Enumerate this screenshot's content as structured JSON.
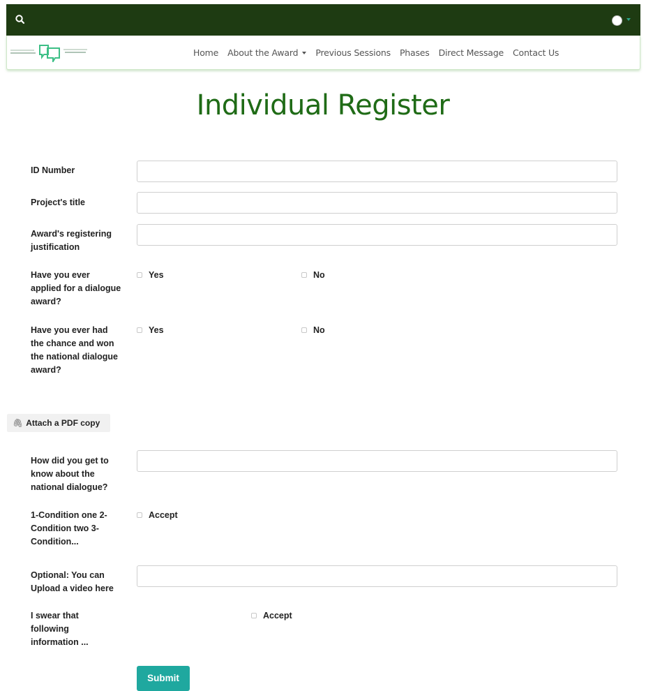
{
  "topbar": {
    "search_icon": "search-icon",
    "avatar_icon": "user-avatar-icon"
  },
  "nav": {
    "logo": "national-dialogue-award-logo",
    "items": [
      "Home",
      "About the Award",
      "Previous Sessions",
      "Phases",
      "Direct Message",
      "Contact Us"
    ]
  },
  "page": {
    "title": "Individual Register"
  },
  "form": {
    "id_number_label": "ID Number",
    "project_title_label": "Project's title",
    "justification_label": "Award's registering justification",
    "applied_label": "Have you ever applied for a dialogue award?",
    "applied_yes": "Yes",
    "applied_no": "No",
    "won_label": "Have you ever had the chance and won the national dialogue award?",
    "won_yes": "Yes",
    "won_no": "No",
    "attach_label": "Attach a PDF copy",
    "know_label": "How did you get to know about the national dialogue?",
    "conditions_label": "1-Condition one 2-Condition two 3-Condition...",
    "conditions_accept": "Accept",
    "video_label": "Optional: You can Upload a video here",
    "swear_label": "I swear that following information ...",
    "swear_accept": "Accept",
    "submit_label": "Submit"
  },
  "colors": {
    "topbar": "#1e3b12",
    "title": "#1f6b16",
    "submit": "#1fa89f"
  }
}
